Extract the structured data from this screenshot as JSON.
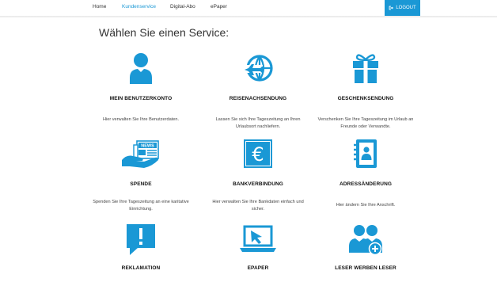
{
  "nav": {
    "items": [
      {
        "label": "Home"
      },
      {
        "label": "Kundenservice",
        "active": true
      },
      {
        "label": "Digital-Abo"
      },
      {
        "label": "ePaper"
      }
    ],
    "logout_label": "LOGOUT"
  },
  "page_title": "Wählen Sie einen Service:",
  "accent_color": "#1a98d5",
  "services": [
    {
      "title": "MEIN BENUTZERKONTO",
      "description": "Hier verwalten Sie Ihre Benutzerdaten.",
      "icon": "user-icon"
    },
    {
      "title": "REISENACHSENDUNG",
      "description": "Lassen Sie sich Ihre Tageszeitung an Ihren Urlaubsort nachliefern.",
      "icon": "globe-plane-icon"
    },
    {
      "title": "GESCHENKSENDUNG",
      "description": "Verschenken Sie Ihre Tageszeitung im Urlaub an Freunde oder Verwandte.",
      "icon": "gift-icon"
    },
    {
      "title": "SPENDE",
      "description": "Spenden Sie Ihre Tageszeitung an eine karitative Einrichtung.",
      "icon": "hand-newspaper-icon",
      "icon_text": "NEWS"
    },
    {
      "title": "BANKVERBINDUNG",
      "description": "Hier verwalten Sie Ihre Bankdaten einfach und sicher.",
      "icon": "euro-icon"
    },
    {
      "title": "ADRESSÄNDERUNG",
      "description": "Hier ändern Sie Ihre Anschrift.",
      "icon": "address-book-icon"
    },
    {
      "title": "REKLAMATION",
      "description": "",
      "icon": "exclamation-icon"
    },
    {
      "title": "EPAPER",
      "description": "",
      "icon": "laptop-cursor-icon"
    },
    {
      "title": "LESER WERBEN LESER",
      "description": "",
      "icon": "users-plus-icon"
    }
  ]
}
